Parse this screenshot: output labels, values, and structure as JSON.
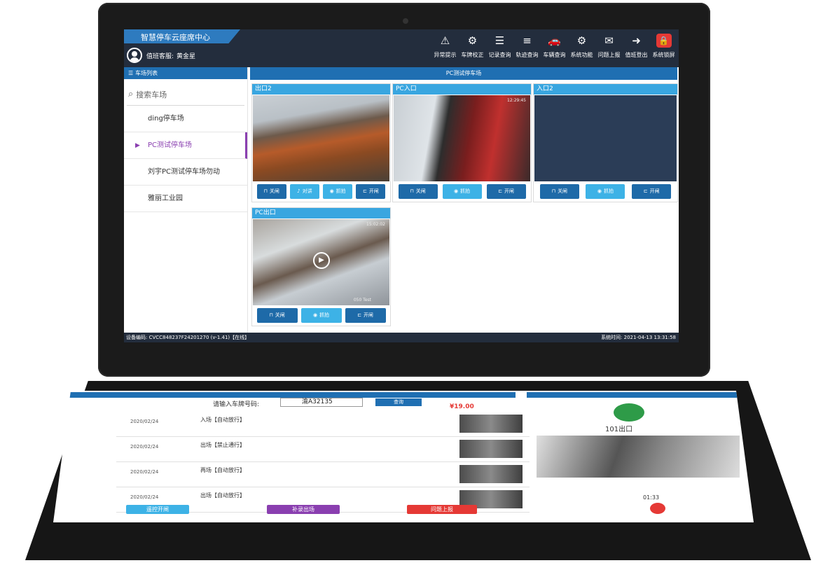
{
  "app": {
    "title": "智慧停车云座席中心",
    "operator_label": "值班客服:",
    "operator_name": "黄金星"
  },
  "toolbar": [
    {
      "icon": "alarm-monitor-icon",
      "glyph": "⚠",
      "label": "异常提示"
    },
    {
      "icon": "plate-correct-icon",
      "glyph": "⚙",
      "label": "车牌校正"
    },
    {
      "icon": "record-clipboard-icon",
      "glyph": "☰",
      "label": "记录查询"
    },
    {
      "icon": "track-list-icon",
      "glyph": "≡",
      "label": "轨迹查询"
    },
    {
      "icon": "car-icon",
      "glyph": "🚗",
      "label": "车辆查询"
    },
    {
      "icon": "settings-monitor-icon",
      "glyph": "⚙",
      "label": "系统功能"
    },
    {
      "icon": "chat-report-icon",
      "glyph": "✉",
      "label": "问题上报"
    },
    {
      "icon": "user-logout-icon",
      "glyph": "➜",
      "label": "值班登出"
    },
    {
      "icon": "lock-icon",
      "glyph": "🔒",
      "label": "系统锁屏"
    }
  ],
  "sidebar": {
    "header": "车场列表",
    "search_placeholder": "搜索车场",
    "lots": [
      {
        "label": "ding停车场",
        "active": false
      },
      {
        "label": "PC测试停车场",
        "active": true
      },
      {
        "label": "刘宇PC测试停车场勿动",
        "active": false
      },
      {
        "label": "雅丽工业园",
        "active": false
      }
    ]
  },
  "main": {
    "header": "PC测试停车场",
    "cameras": [
      {
        "name": "出口2",
        "buttons": [
          {
            "icon": "barrier-close-icon",
            "label": "关闸"
          },
          {
            "icon": "microphone-icon",
            "label": "对讲"
          },
          {
            "icon": "camera-icon",
            "label": "抓拍"
          },
          {
            "icon": "barrier-open-icon",
            "label": "开闸"
          }
        ]
      },
      {
        "name": "PC入口",
        "time": "12:29:45",
        "buttons": [
          {
            "icon": "barrier-close-icon",
            "label": "关闸"
          },
          {
            "icon": "camera-icon",
            "label": "抓拍"
          },
          {
            "icon": "barrier-open-icon",
            "label": "开闸"
          }
        ]
      },
      {
        "name": "入口2",
        "buttons": [
          {
            "icon": "barrier-close-icon",
            "label": "关闸"
          },
          {
            "icon": "camera-icon",
            "label": "抓拍"
          },
          {
            "icon": "barrier-open-icon",
            "label": "开闸"
          }
        ]
      },
      {
        "name": "PC出口",
        "time": "15:02:02",
        "overlay": "050 Test",
        "buttons": [
          {
            "icon": "barrier-close-icon",
            "label": "关闸"
          },
          {
            "icon": "camera-icon",
            "label": "抓拍"
          },
          {
            "icon": "barrier-open-icon",
            "label": "开闸"
          }
        ]
      }
    ]
  },
  "status": {
    "device_code": "设备编码: CVCC848237F24201270 (v-1.41)【在线】",
    "system_time": "系统时间: 2021-04-13 13:31:58"
  },
  "lower_screen": {
    "plate_label": "请输入车牌号码:",
    "plate_value": "渝A32135",
    "query_label": "查询",
    "price": "¥19.00",
    "rows": [
      {
        "date": "2020/02/24",
        "event": "入场【自动放行】"
      },
      {
        "date": "2020/02/24",
        "event": "出场【禁止通行】"
      },
      {
        "date": "2020/02/24",
        "event": "再场【自动放行】"
      },
      {
        "date": "2020/02/24",
        "event": "出场【自动放行】"
      }
    ],
    "buttons": [
      {
        "label": "遥控开闸",
        "color": "#3db2e6"
      },
      {
        "label": "补录出场",
        "color": "#8a3fb0"
      },
      {
        "label": "问题上报",
        "color": "#e53935"
      }
    ],
    "call_name": "101出口",
    "call_timer": "01:33"
  }
}
